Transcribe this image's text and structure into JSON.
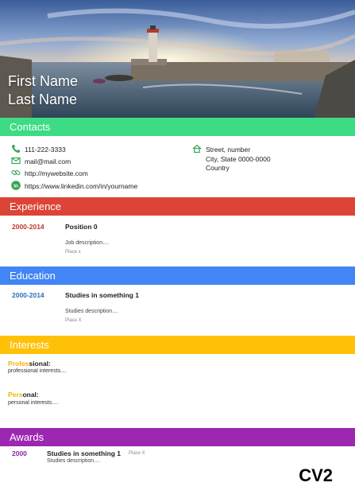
{
  "header": {
    "first_name": "First Name",
    "last_name": "Last Name"
  },
  "contacts": {
    "title": "Contacts",
    "phone": "111-222-3333",
    "email": "mail@mail.com",
    "website": "http://mywebsite.com",
    "linkedin": "https://www.linkedin.com/in/yourname",
    "address_line1": "Street, number",
    "address_line2": "City, State 0000-0000",
    "address_line3": "Country"
  },
  "experience": {
    "title": "Experience",
    "dates": "2000-2014",
    "position": "Position 0",
    "description": "Job description....",
    "place": "Place x"
  },
  "education": {
    "title": "Education",
    "dates": "2000-2014",
    "degree": "Studies in something 1",
    "description": "Studies description....",
    "place": "Place X"
  },
  "interests": {
    "title": "Interests",
    "professional_label_hl": "Profes",
    "professional_label_rest": "sional:",
    "professional_text": "professional interests....",
    "personal_label_hl": "Pers",
    "personal_label_rest": "onal:",
    "personal_text": "personal interests...."
  },
  "awards": {
    "title": "Awards",
    "year": "2000",
    "award": "Studies in something 1",
    "place": "Place X",
    "description": "Studies description...."
  },
  "footer": {
    "tag": "CV2"
  },
  "colors": {
    "contacts": "#3ddc84",
    "experience": "#db4437",
    "education": "#4285f4",
    "interests": "#ffc107",
    "awards": "#9c27b0",
    "exp_date": "#c0392b",
    "edu_date": "#2f6fb5",
    "awards_date": "#8e24aa",
    "icon_green": "#3aa655"
  },
  "icons": [
    "phone-icon",
    "mail-icon",
    "link-icon",
    "linkedin-icon",
    "home-icon"
  ]
}
